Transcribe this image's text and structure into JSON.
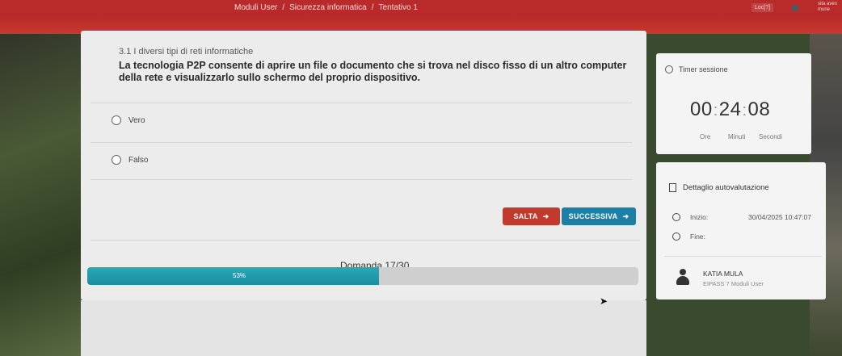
{
  "breadcrumb": {
    "items": [
      "Moduli User",
      "Sicurezza informatica",
      "Tentativo 1"
    ]
  },
  "header": {
    "lang_label": "Loc[?]",
    "user_mini": [
      "sita aven",
      "mune"
    ]
  },
  "question": {
    "section": "3.1 I diversi tipi di reti informatiche",
    "text": "La tecnologia P2P consente di aprire un file o documento che si trova nel disco fisso di un altro computer della rete e visualizzarlo sullo schermo del proprio dispositivo.",
    "options": [
      {
        "label": "Vero",
        "selected": false
      },
      {
        "label": "Falso",
        "selected": false
      }
    ]
  },
  "buttons": {
    "skip": "SALTA",
    "next": "SUCCESSIVA"
  },
  "progress": {
    "counter": "Domanda 17/30",
    "percent_label": "53%",
    "fraction": 0.53
  },
  "timer": {
    "title": "Timer sessione",
    "hours": "00",
    "minutes": "24",
    "seconds": "08",
    "units": [
      "Ore",
      "Minuti",
      "Secondi"
    ]
  },
  "details": {
    "title": "Dettaglio autovalutazione",
    "start_label": "Inizio:",
    "start_value": "30/04/2025 10:47:07",
    "end_label": "Fine:"
  },
  "user": {
    "name": "KATIA MULA",
    "sub": "EIPASS 7 Moduli User"
  },
  "colors": {
    "topbar": "#b92b2b",
    "skip_button": "#c23a2e",
    "next_button": "#1c7fa6",
    "progress_fill": "#1a8ea0"
  }
}
